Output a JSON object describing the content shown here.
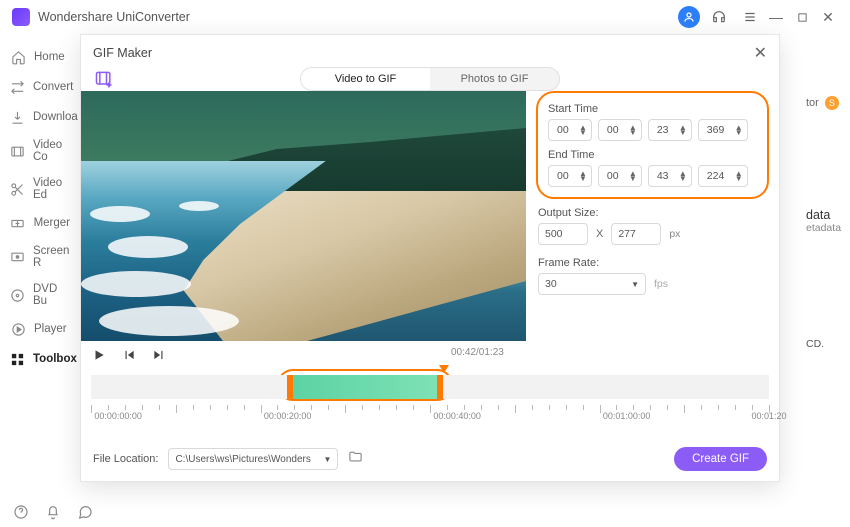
{
  "app": {
    "title": "Wondershare UniConverter"
  },
  "sidebar": {
    "items": [
      {
        "label": "Home"
      },
      {
        "label": "Convert"
      },
      {
        "label": "Downloa"
      },
      {
        "label": "Video Co"
      },
      {
        "label": "Video Ed"
      },
      {
        "label": "Merger"
      },
      {
        "label": "Screen R"
      },
      {
        "label": "DVD Bu"
      },
      {
        "label": "Player"
      },
      {
        "label": "Toolbox"
      }
    ]
  },
  "right_strip": {
    "tor": "tor",
    "badge": "S",
    "data": "data",
    "metadata": "etadata",
    "cd": "CD."
  },
  "modal": {
    "title": "GIF Maker",
    "tabs": {
      "video": "Video to GIF",
      "photos": "Photos to GIF"
    },
    "timecode": "00:42/01:23",
    "start_label": "Start Time",
    "end_label": "End Time",
    "start": {
      "hh": "00",
      "mm": "00",
      "ss": "23",
      "ms": "369"
    },
    "end": {
      "hh": "00",
      "mm": "00",
      "ss": "43",
      "ms": "224"
    },
    "output_label": "Output Size:",
    "output": {
      "w": "500",
      "x": "X",
      "h": "277",
      "px": "px"
    },
    "framerate_label": "Frame Rate:",
    "framerate": {
      "value": "30",
      "unit": "fps"
    },
    "ruler": [
      "00:00:00:00",
      "00:00:20:00",
      "00:00:40:00",
      "00:01:00:00",
      "00:01:20"
    ],
    "file_location_label": "File Location:",
    "file_location": "C:\\Users\\ws\\Pictures\\Wonders",
    "create": "Create GIF"
  }
}
